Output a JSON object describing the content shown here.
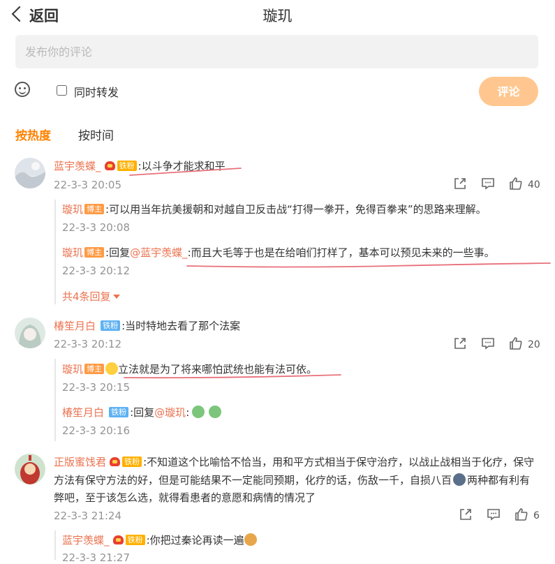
{
  "header": {
    "back_label": "返回",
    "title": "璇玑"
  },
  "composer": {
    "placeholder": "发布你的评论",
    "repost_label": "同时转发",
    "submit_label": "评论"
  },
  "sort_tabs": {
    "hot": "按热度",
    "time": "按时间"
  },
  "comments": [
    {
      "user": "蓝宇羡蝶_",
      "badge": "铁粉",
      "text": ":以斗争才能求和平",
      "time": "22-3-3 20:05",
      "likes": "40",
      "replies": [
        {
          "user": "璇玑",
          "badge": "博主",
          "text": ":可以用当年抗美援朝和对越自卫反击战“打得一拳开，免得百拳来”的思路来理解。",
          "time": "22-3-3 20:08"
        },
        {
          "user": "璇玑",
          "badge": "博主",
          "prefix": ":回复",
          "mention": "@蓝宇羡蝶_",
          "text": ":而且大毛等于也是在给咱们打样了，基本可以预见未来的一些事。",
          "time": "22-3-3 20:12"
        }
      ],
      "more_replies": "共4条回复"
    },
    {
      "user": "椿笙月白",
      "badge": "铁粉",
      "text": ":当时特地去看了那个法案",
      "time": "22-3-3 20:12",
      "likes": "20",
      "replies": [
        {
          "user": "璇玑",
          "badge": "博主",
          "text": "立法就是为了将来哪怕武统也能有法可依。",
          "time": "22-3-3 20:15"
        },
        {
          "user": "椿笙月白",
          "badge": "铁粉",
          "prefix": ":回复",
          "mention": "@璇玑",
          "text": ":",
          "time": "22-3-3 20:16"
        }
      ]
    },
    {
      "user": "正版蜜饯君",
      "badge": "铁粉",
      "text_line1": ":不知道这个比喻恰不恰当，用和平方式相当于保守治疗，以战止战相当于化疗，保守",
      "text_line2a": "方法有保守方法的好，但是可能结果不一定能同预期，化疗的话，伤敌一千，自损八百",
      "text_line2b": "两种都有利有",
      "text_line3": "弊吧，至于该怎么选，就得看患者的意愿和病情的情况了",
      "time": "22-3-3 21:24",
      "likes": "6",
      "replies": [
        {
          "user": "蓝宇羡蝶_",
          "badge": "铁粉",
          "text": ":你把过秦论再读一遍",
          "time": "22-3-3 21:27"
        }
      ]
    }
  ],
  "icons": [
    "back-chevron-icon",
    "emoji-icon",
    "share-icon",
    "comment-icon",
    "like-icon"
  ],
  "colors": {
    "accent": "#ff8200",
    "username": "#eb7350",
    "submit_bg": "#ffc78f",
    "underline": "#e8707a"
  }
}
